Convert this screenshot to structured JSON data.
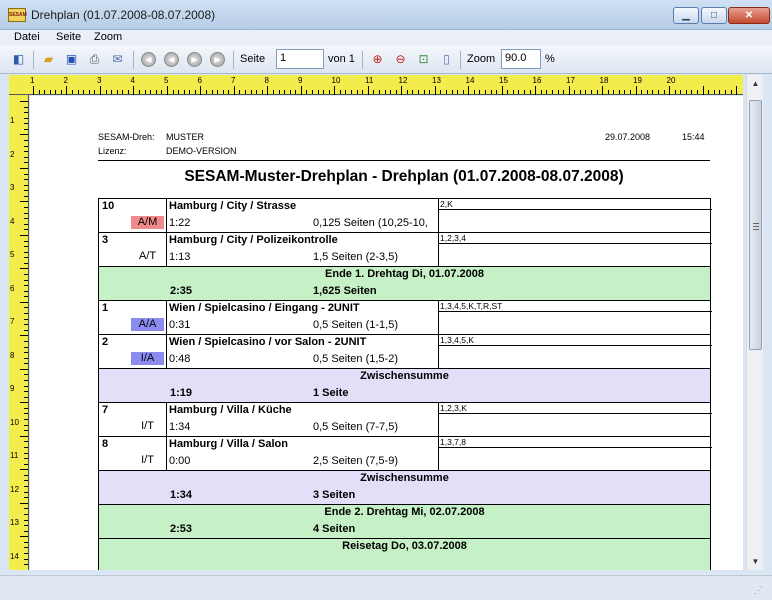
{
  "window": {
    "title": "Drehplan (01.07.2008-08.07.2008)",
    "app_icon_text": "SESAM"
  },
  "menu": [
    "Datei",
    "Seite",
    "Zoom"
  ],
  "toolbar": {
    "seite_label": "Seite",
    "page_value": "1",
    "von_label": "von 1",
    "zoom_label": "Zoom",
    "zoom_value": "90.0",
    "percent_label": "%"
  },
  "ruler": {
    "h_labels": [
      "1",
      "2",
      "3",
      "4",
      "5",
      "6",
      "7",
      "8",
      "9",
      "10",
      "11",
      "12",
      "13",
      "14",
      "15",
      "16",
      "17",
      "18",
      "19",
      "20"
    ],
    "v_labels": [
      "1",
      "2",
      "3",
      "4",
      "5",
      "6",
      "7",
      "8",
      "9",
      "10",
      "11",
      "12",
      "13",
      "14"
    ]
  },
  "report": {
    "header": {
      "sesam_label": "SESAM-Dreh:",
      "sesam_value": "MUSTER",
      "lizenz_label": "Lizenz:",
      "lizenz_value": "DEMO-VERSION",
      "date": "29.07.2008",
      "time": "15:44"
    },
    "title": "SESAM-Muster-Drehplan - Drehplan (01.07.2008-08.07.2008)"
  },
  "rows": [
    {
      "kind": "scene",
      "num": "10",
      "type": "A/M",
      "type_color": "#f08a8a",
      "location": "Hamburg / City / Strasse",
      "duration": "1:22",
      "pages": "0,125 Seiten (10,25-10,",
      "cast": "2,K"
    },
    {
      "kind": "scene",
      "num": "3",
      "type": "A/T",
      "type_color": "",
      "location": "Hamburg  / City / Polizeikontrolle",
      "duration": "1:13",
      "pages": "1,5 Seiten (2-3,5)",
      "cast": "1,2,3,4"
    },
    {
      "kind": "sum",
      "color": "green",
      "line1": "Ende 1. Drehtag   Di, 01.07.2008",
      "line2a": "2:35",
      "line2b": "1,625 Seiten"
    },
    {
      "kind": "scene",
      "num": "1",
      "type": "A/A",
      "type_color": "#8c8cf0",
      "location": "Wien  / Spielcasino / Eingang  - 2UNIT",
      "duration": "0:31",
      "pages": "0,5 Seiten (1-1,5)",
      "cast": "1,3,4,5,K,T,R,ST"
    },
    {
      "kind": "scene",
      "num": "2",
      "type": "I/A",
      "type_color": "#8c8cf0",
      "location": "Wien  / Spielcasino / vor Salon  - 2UNIT",
      "duration": "0:48",
      "pages": "0,5 Seiten (1,5-2)",
      "cast": "1,3,4,5,K"
    },
    {
      "kind": "sum",
      "color": "lilac",
      "line1": "Zwischensumme",
      "line2a": "1:19",
      "line2b": "1 Seite"
    },
    {
      "kind": "scene",
      "num": "7",
      "type": "I/T",
      "type_color": "",
      "location": "Hamburg / Villa / Küche",
      "duration": "1:34",
      "pages": "0,5 Seiten (7-7,5)",
      "cast": "1,2,3,K"
    },
    {
      "kind": "scene",
      "num": "8",
      "type": "I/T",
      "type_color": "",
      "location": "Hamburg / Villa / Salon",
      "duration": "0:00",
      "pages": "2,5 Seiten (7,5-9)",
      "cast": "1,3,7,8"
    },
    {
      "kind": "sum",
      "color": "lilac",
      "line1": "Zwischensumme",
      "line2a": "1:34",
      "line2b": "3 Seiten"
    },
    {
      "kind": "sum",
      "color": "green",
      "line1": "Ende 2. Drehtag   Mi, 02.07.2008",
      "line2a": "2:53",
      "line2b": "4 Seiten"
    },
    {
      "kind": "sum",
      "color": "green",
      "line1": "Reisetag   Do, 03.07.2008",
      "line2a": "",
      "line2b": ""
    }
  ]
}
